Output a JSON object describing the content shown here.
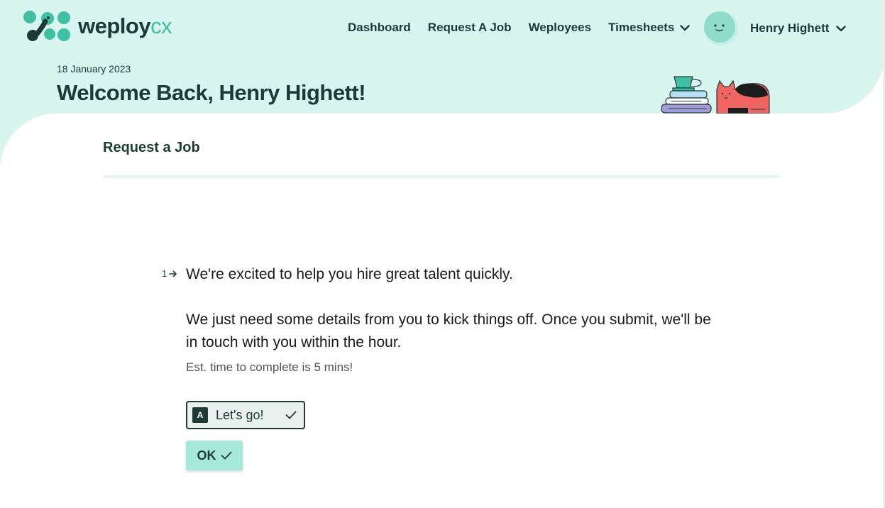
{
  "brand": {
    "logo_word": "weploy",
    "logo_suffix": "cx",
    "accent": "#3fbfa4",
    "dark": "#1d3a37",
    "band_color": "#d8f5ef"
  },
  "nav": {
    "items": [
      {
        "label": "Dashboard"
      },
      {
        "label": "Request A Job"
      },
      {
        "label": "Weployees"
      },
      {
        "label": "Timesheets",
        "icon": "chevron-down-icon"
      }
    ]
  },
  "user": {
    "name": "Henry Highett",
    "avatar_icon": "smiley-face-icon"
  },
  "header": {
    "date": "18 January 2023",
    "welcome": "Welcome Back, Henry Highett!"
  },
  "form": {
    "section_title": "Request a Job",
    "question_number": "1",
    "question_line1": "We're excited to help you hire great talent quickly.",
    "question_line2": "We just need some details from you to kick things off. Once you submit, we'll be in touch with you within the hour.",
    "estimate": "Est. time to complete is 5 mins!",
    "choice": {
      "key": "A",
      "label": "Let's go!",
      "selected": true
    },
    "ok_label": "OK"
  }
}
